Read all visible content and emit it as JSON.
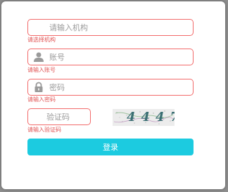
{
  "form": {
    "org": {
      "placeholder": "请输入机构",
      "error": "请选择机构"
    },
    "account": {
      "placeholder": "账号",
      "error": "请输入账号"
    },
    "password": {
      "placeholder": "密码",
      "error": "请输入密码"
    },
    "captcha": {
      "placeholder": "验证码",
      "error": "请输入验证码",
      "image_text": "4447"
    },
    "submit_label": "登录"
  },
  "colors": {
    "error": "#e15454",
    "border": "#f26a6a",
    "button": "#1ccbe0",
    "icon": "#9a9a9a"
  },
  "icons": {
    "account": "user-icon",
    "password": "lock-icon"
  }
}
